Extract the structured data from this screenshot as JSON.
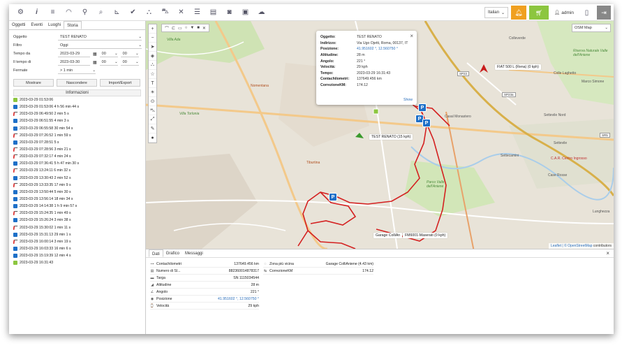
{
  "toolbar": {
    "icons": [
      "settings-gear",
      "info",
      "list",
      "speedometer",
      "map-pin",
      "search",
      "chart",
      "check",
      "binoculars",
      "car",
      "tools",
      "database",
      "calendar",
      "camera",
      "sim-card",
      "antenna"
    ],
    "language": "Italian",
    "user": "admin"
  },
  "left_panel": {
    "tabs": [
      "Oggetti",
      "Eventi",
      "Luoghi",
      "Storia"
    ],
    "active_tab": "Storia",
    "form": {
      "oggetto_label": "Oggetto",
      "oggetto_value": "TEST RENATO",
      "filtro_label": "Filtro",
      "filtro_value": "Oggi",
      "tempo_da_label": "Tempo da",
      "tempo_da_date": "2023-03-29",
      "tempo_da_h": "00",
      "tempo_da_m": "00",
      "tempo_di_label": "Il tempo di",
      "tempo_di_date": "2023-03-30",
      "tempo_di_h": "00",
      "tempo_di_m": "00",
      "fermate_label": "Fermate",
      "fermate_value": "> 1 min"
    },
    "buttons": {
      "mostrare": "Mostrare",
      "nascondere": "Nascondere",
      "import_export": "Import/Export"
    },
    "info_header": "Informazioni",
    "events": [
      {
        "type": "green",
        "text": "2023-03-29 01:53:06"
      },
      {
        "type": "blue",
        "text": "2023-03-29 01:53:06  4 h 56 min 44 s"
      },
      {
        "type": "red",
        "text": "2023-03-29 06:49:50  2 min 5 s"
      },
      {
        "type": "blue",
        "text": "2023-03-29 06:51:55  4 min 3 s"
      },
      {
        "type": "blue",
        "text": "2023-03-29 06:55:58  30 min 54 s"
      },
      {
        "type": "red",
        "text": "2023-03-29 07:26:52  1 min 59 s"
      },
      {
        "type": "blue",
        "text": "2023-03-29 07:28:51  5 s"
      },
      {
        "type": "red",
        "text": "2023-03-29 07:28:56  3 min 21 s"
      },
      {
        "type": "red",
        "text": "2023-03-29 07:32:17  4 min 24 s"
      },
      {
        "type": "blue",
        "text": "2023-03-29 07:36:41  5 h 47 min 30 s"
      },
      {
        "type": "red",
        "text": "2023-03-29 13:24:11  6 min 32 s"
      },
      {
        "type": "blue",
        "text": "2023-03-29 13:30:43  2 min 52 s"
      },
      {
        "type": "red",
        "text": "2023-03-29 13:33:35  17 min 9 s"
      },
      {
        "type": "blue",
        "text": "2023-03-29 13:50:44  5 min 30 s"
      },
      {
        "type": "blue",
        "text": "2023-03-29 13:56:14  18 min 34 s"
      },
      {
        "type": "blue",
        "text": "2023-03-29 14:14:38  1 h 9 min 57 s"
      },
      {
        "type": "red",
        "text": "2023-03-29 15:24:35  1 min 49 s"
      },
      {
        "type": "blue",
        "text": "2023-03-29 15:26:24  3 min 38 s"
      },
      {
        "type": "red",
        "text": "2023-03-29 15:30:02  1 min 11 s"
      },
      {
        "type": "blue",
        "text": "2023-03-29 15:31:13  29 min 1 s"
      },
      {
        "type": "red",
        "text": "2023-03-29 16:00:14  3 min 19 s"
      },
      {
        "type": "blue",
        "text": "2023-03-29 16:03:33  16 min 6 s"
      },
      {
        "type": "blue",
        "text": "2023-03-29 15:19:39  12 min 4 s"
      },
      {
        "type": "green",
        "text": "2023-03-29 16:31:43"
      }
    ]
  },
  "map": {
    "layer_select": "OSM Map",
    "popup": {
      "rows": [
        {
          "k": "Oggetto:",
          "v": "TEST RENATO",
          "link": false
        },
        {
          "k": "Indirizzo:",
          "v": "Via Ugo Ojetti, Roma, 00137, IT",
          "link": false
        },
        {
          "k": "Posizione:",
          "v": "41.951602 °, 12.560750 °",
          "link": true
        },
        {
          "k": "Altitudine:",
          "v": "28 m",
          "link": false
        },
        {
          "k": "Angolo:",
          "v": "221 °",
          "link": false
        },
        {
          "k": "Velocità:",
          "v": "29 kph",
          "link": false
        },
        {
          "k": "Tempo:",
          "v": "2023-03-29 16:31:43",
          "link": false
        },
        {
          "k": "Contachilometri:",
          "v": "137649.456 km",
          "link": false
        },
        {
          "k": "CorrezioneKM:",
          "v": "174.12",
          "link": false
        }
      ],
      "more": "Show"
    },
    "marker_labels": {
      "test_renato": "TEST RENATO (15 kph)",
      "fiat": "FIAT 500 L (Rena) (0 kph)",
      "garage": "Garage ColliAn",
      "fm6001": "FM6001-Maserati (0 kph)"
    },
    "place_labels": [
      "Colleverde",
      "Riserva Naturale Valle dell'Aniene",
      "Casal Monastero",
      "Settecamini",
      "Case Rosse",
      "Parco Valle dell'Aniene",
      "Colle Laghetto",
      "Marco Simone",
      "Settevile Nord",
      "Settevile",
      "C.A.R. Centro Ingrosso",
      "Villa Ada",
      "Lunghezza",
      "Tiburtina",
      "Nomentana",
      "Villa Torlonia"
    ],
    "road_badges": [
      "SP22",
      "SR5",
      "SP23a"
    ],
    "attribution_prefix": "Leaflet | ©",
    "attribution_link": "OpenStreetMap",
    "attribution_suffix": "contributors"
  },
  "details": {
    "tabs": [
      "Dati",
      "Grafico",
      "Messaggi"
    ],
    "active_tab": "Dati",
    "left_rows": [
      {
        "icon": "odometer-icon",
        "k": "Contachilometri",
        "v": "137649.456 km",
        "link": false
      },
      {
        "icon": "document-icon",
        "k": "Numero di SI...",
        "v": "882360014878317",
        "link": false
      },
      {
        "icon": "plate-icon",
        "k": "Targa",
        "v": "SN 1115034544",
        "link": false
      },
      {
        "icon": "altitude-icon",
        "k": "Altitudine",
        "v": "28 m",
        "link": false
      },
      {
        "icon": "angle-icon",
        "k": "Angolo",
        "v": "221 °",
        "link": false
      },
      {
        "icon": "position-icon",
        "k": "Posizione",
        "v": "41.951602 °, 12.560750 °",
        "link": true
      },
      {
        "icon": "speed-icon",
        "k": "Velocità",
        "v": "29 kph",
        "link": false
      }
    ],
    "right_rows": [
      {
        "icon": "zone-icon",
        "k": "Zona più vicina",
        "v": "Garage ColliAniene (4.43 km)"
      },
      {
        "icon": "correction-icon",
        "k": "CorrezioneKM",
        "v": "174.12"
      }
    ]
  }
}
